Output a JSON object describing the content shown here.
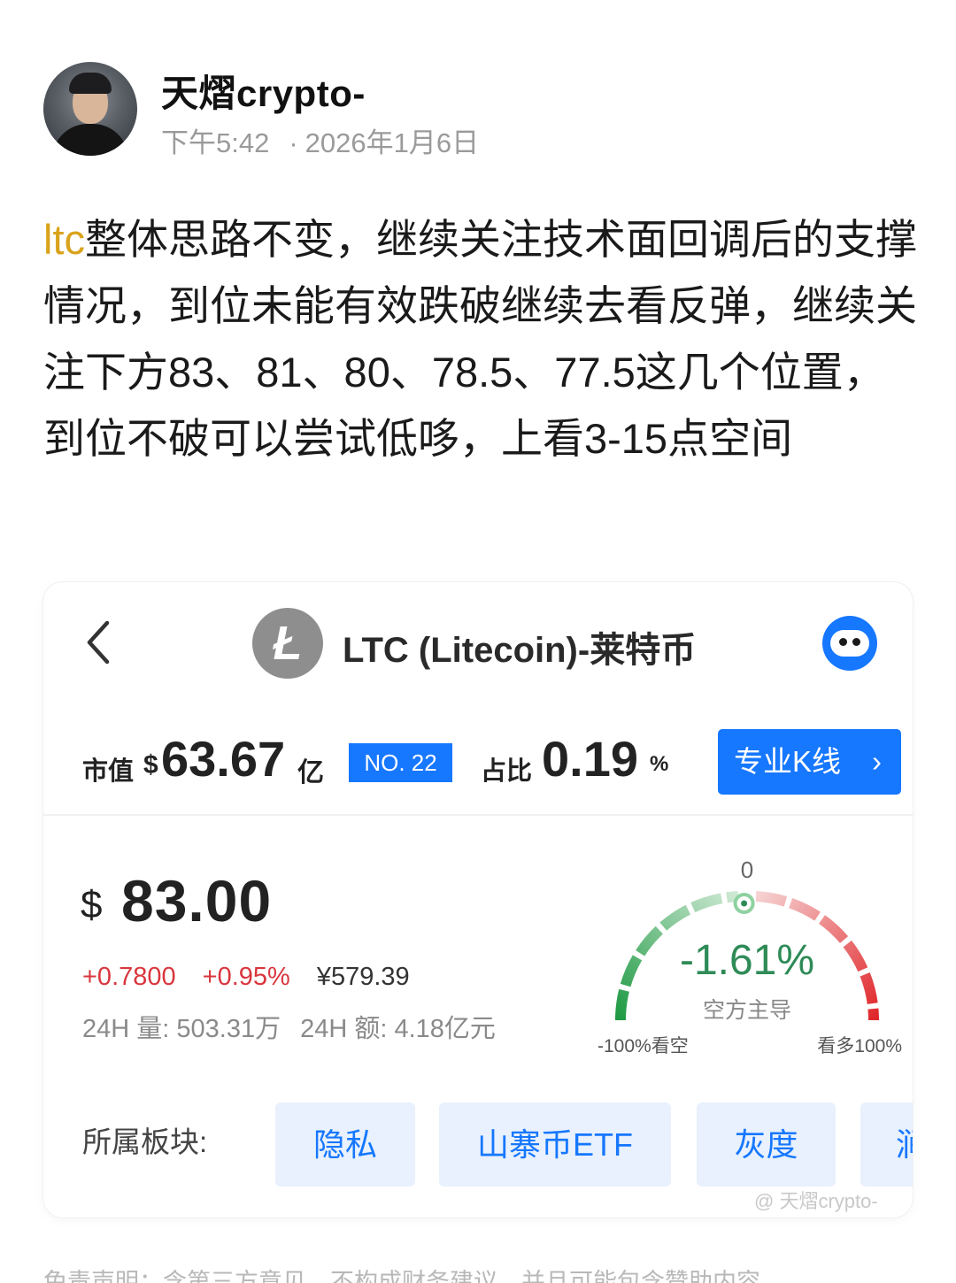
{
  "author": {
    "name": "天熠crypto-",
    "time": "下午5:42",
    "date": "2026年1月6日",
    "separator": "·"
  },
  "post": {
    "tag": "ltc",
    "body": "整体思路不变，继续关注技术面回调后的支撑情况，到位未能有效跌破继续去看反弹，继续关注下方83、81、80、78.5、77.5这几个位置，到位不破可以尝试低哆，上看3-15点空间"
  },
  "card": {
    "title": "LTC (Litecoin)-莱特币",
    "logo_letter": "Ł",
    "market_cap_label": "市值",
    "market_cap_currency": "$",
    "market_cap_value": "63.67",
    "market_cap_unit": "亿",
    "rank": "NO. 22",
    "share_label": "占比",
    "share_value": "0.19",
    "share_unit": "%",
    "kline_button": "专业K线",
    "kline_chevron": "›",
    "price_currency": "$",
    "price_value": "83.00",
    "change_abs": "+0.7800",
    "change_pct": "+0.95%",
    "price_cny": "¥579.39",
    "vol_label": "24H 量: 503.31万",
    "amt_label": "24H 额: 4.18亿元",
    "gauge": {
      "top_label": "0",
      "value": "-1.61%",
      "value_num": -1.61,
      "sentiment": "空方主导",
      "left_label": "-100%看空",
      "right_label": "看多100%"
    },
    "sector_label": "所属板块:",
    "sectors": [
      "隐私",
      "山寨币ETF",
      "灰度",
      "涧"
    ]
  },
  "watermark": "@ 天熠crypto-",
  "disclaimer": "免责声明：含第三方意见，不构成财务建议，并且可能包含赞助内容",
  "colors": {
    "accent": "#1677ff",
    "up": "#d9363e",
    "bearish": "#2e8b57",
    "tag": "#d9a31a"
  }
}
